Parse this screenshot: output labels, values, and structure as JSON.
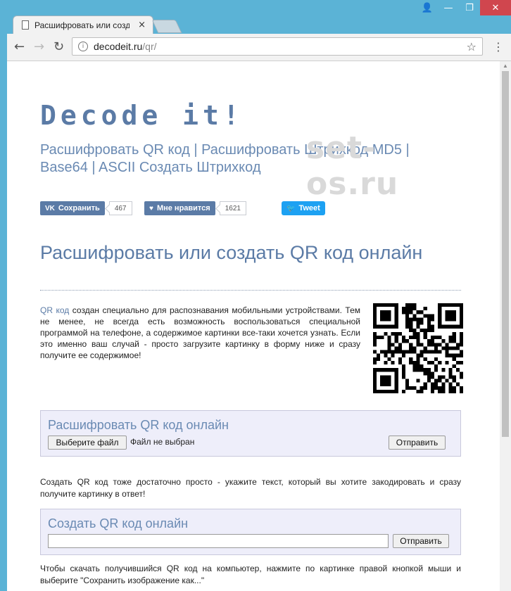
{
  "browser": {
    "tab_title": "Расшифровать или созд",
    "tab_close": "×",
    "url_host": "decodeit.ru",
    "url_path": "/qr/",
    "nav_back": "←",
    "nav_forward": "→",
    "nav_reload": "↻",
    "star": "☆",
    "menu": "⋮",
    "info": "i"
  },
  "window": {
    "user": "👤",
    "minimize": "—",
    "maximize": "❐",
    "close": "✕"
  },
  "site": {
    "logo": "Decode it!",
    "nav_links": "Расшифровать QR код | Расшифровать Штрихкод MD5 | Base64 | ASCII Создать Штрихкод",
    "watermark": "set-os.ru"
  },
  "social": {
    "vk_label": "Сохранить",
    "vk_icon": "VK",
    "vk_count": "467",
    "like_label": "Мне нравится",
    "like_icon": "♥",
    "like_count": "1621",
    "tweet_label": "Tweet",
    "tweet_icon": "🐦"
  },
  "main": {
    "heading": "Расшифровать или создать QR код онлайн",
    "intro_link": "QR код",
    "intro_text": " создан специально для распознавания мобильными устройствами. Тем не менее, не всегда есть возможность воспользоваться специальной программой на телефоне, а содержимое картинки все-таки хочется узнать. Если это именно ваш случай - просто загрузите картинку в форму ниже и сразу получите ее содержимое!",
    "decode_title": "Расшифровать QR код онлайн",
    "choose_file": "Выберите файл",
    "no_file": "Файл не выбран",
    "submit": "Отправить",
    "create_intro": "Создать QR код тоже достаточно просто - укажите текст, который вы хотите закодировать и сразу получите картинку в ответ!",
    "create_title": "Создать QR код онлайн",
    "create_input_value": "",
    "create_submit": "Отправить",
    "download_hint": "Чтобы скачать получившийся QR код на компьютер, нажмите по картинке правой кнопкой мыши и выберите \"Сохранить изображение как...\""
  }
}
